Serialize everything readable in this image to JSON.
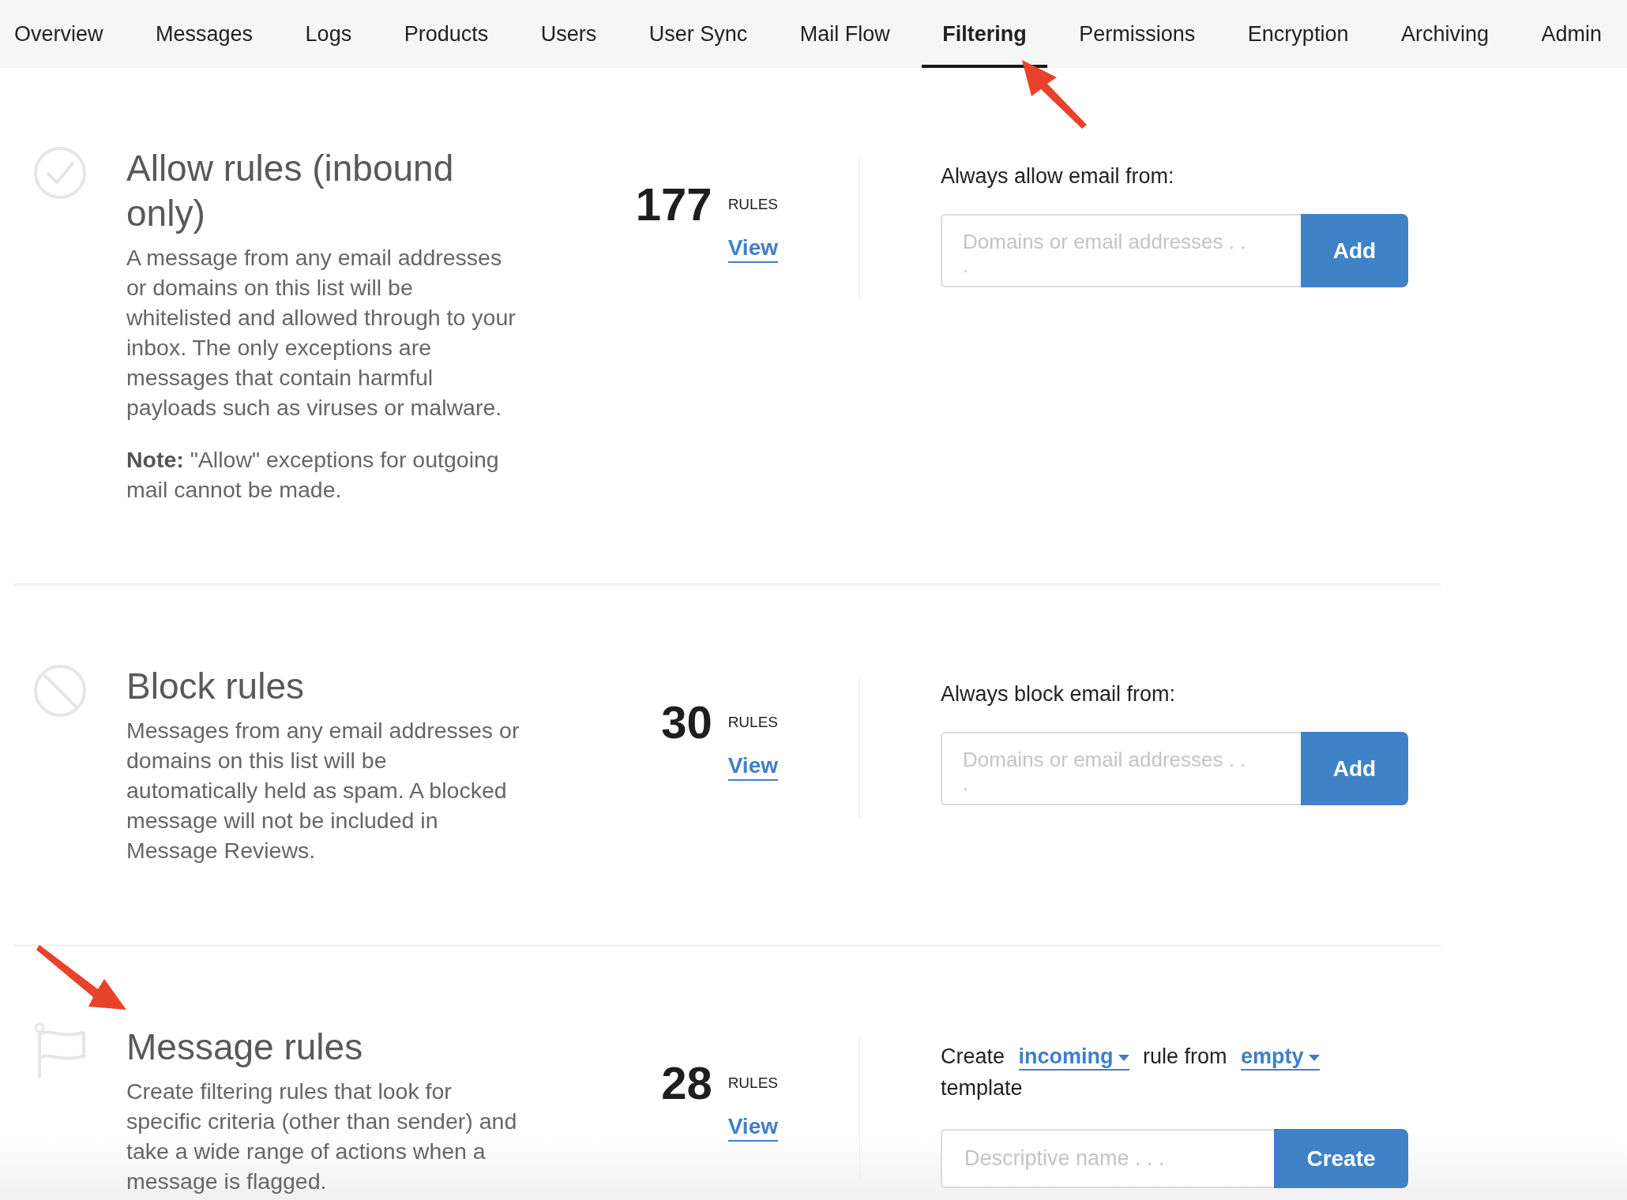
{
  "tabs": [
    {
      "label": "Overview",
      "selected": false
    },
    {
      "label": "Messages",
      "selected": false
    },
    {
      "label": "Logs",
      "selected": false
    },
    {
      "label": "Products",
      "selected": false
    },
    {
      "label": "Users",
      "selected": false
    },
    {
      "label": "User Sync",
      "selected": false
    },
    {
      "label": "Mail Flow",
      "selected": false
    },
    {
      "label": "Filtering",
      "selected": true
    },
    {
      "label": "Permissions",
      "selected": false
    },
    {
      "label": "Encryption",
      "selected": false
    },
    {
      "label": "Archiving",
      "selected": false
    },
    {
      "label": "Admin",
      "selected": false
    }
  ],
  "sections": [
    {
      "kind": "allow",
      "title": "Allow rules (inbound only)",
      "description": "A message from any email addresses or domains on this list will be whitelisted and allowed through to your inbox. The only exceptions are messages that contain harmful payloads such as viruses or malware.",
      "note": "**Note:** \"Allow\" exceptions for outgoing mail cannot be made.",
      "count": "177",
      "count_unit": "RULES",
      "link": "View",
      "form": {
        "kind": "add",
        "label": "Always allow email from:",
        "placeholder": "Domains or email addresses . . .",
        "button": "Add"
      }
    },
    {
      "kind": "block",
      "title": "Block rules",
      "description": "Messages from any email addresses or domains on this list will be automatically held as spam. A blocked message will not be included in Message Reviews.",
      "count": "30",
      "count_unit": "RULES",
      "link": "View",
      "form": {
        "kind": "add",
        "label": "Always block email from:",
        "placeholder": "Domains or email addresses . . .",
        "button": "Add"
      }
    },
    {
      "kind": "message",
      "title": "Message rules",
      "description": "Create filtering rules that look for specific criteria (other than sender) and take a wide range of actions when a message is flagged.",
      "count": "28",
      "count_unit": "RULES",
      "link": "View",
      "form": {
        "kind": "create",
        "sentence": [
          {
            "kind": "text",
            "text": "Create"
          },
          {
            "kind": "dropdown",
            "text": "incoming"
          },
          {
            "kind": "text",
            "text": "rule from"
          },
          {
            "kind": "dropdown",
            "text": "empty"
          },
          {
            "kind": "text",
            "text": "template"
          }
        ],
        "placeholder": "Descriptive name . . .",
        "button": "Create"
      }
    }
  ]
}
